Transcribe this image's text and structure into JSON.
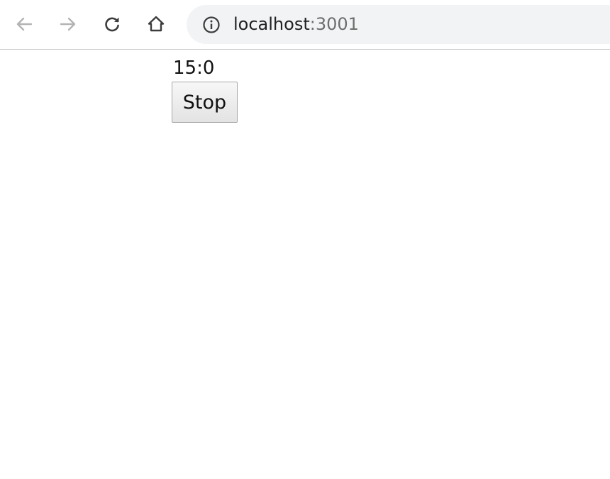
{
  "browser": {
    "url_host": "localhost",
    "url_port": ":3001",
    "icons": {
      "back": "arrow-left-icon",
      "forward": "arrow-right-icon",
      "reload": "reload-icon",
      "home": "home-icon",
      "site_info": "info-icon"
    }
  },
  "page": {
    "timer_text": "15:0",
    "stop_label": "Stop"
  }
}
